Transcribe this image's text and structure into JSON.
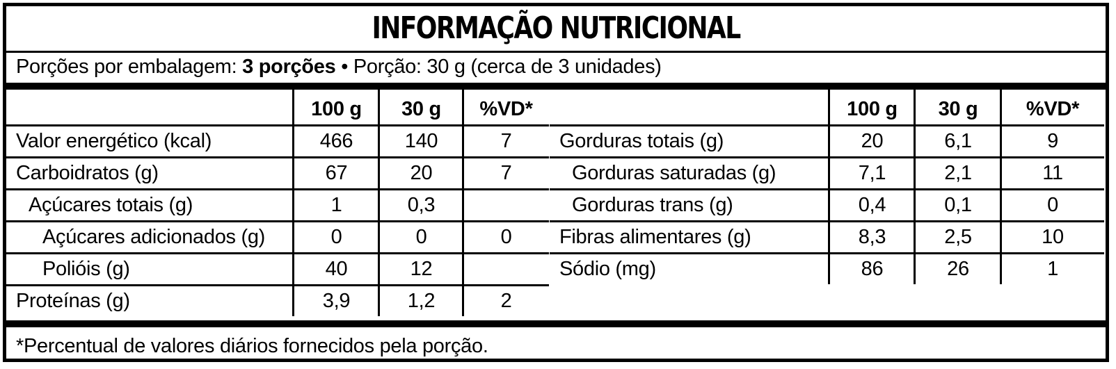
{
  "title": "INFORMAÇÃO NUTRICIONAL",
  "serving": {
    "prefix": "Porções por embalagem: ",
    "portions": "3 porções",
    "suffix": " • Porção: 30 g (cerca de 3 unidades)"
  },
  "columns": [
    "100 g",
    "30 g",
    "%VD*"
  ],
  "left_rows": [
    {
      "label": "Valor energético (kcal)",
      "v100": "466",
      "v30": "140",
      "vd": "7",
      "indent": 0
    },
    {
      "label": "Carboidratos (g)",
      "v100": "67",
      "v30": "20",
      "vd": "7",
      "indent": 0
    },
    {
      "label": "Açúcares totais (g)",
      "v100": "1",
      "v30": "0,3",
      "vd": "",
      "indent": 1
    },
    {
      "label": "Açúcares adicionados (g)",
      "v100": "0",
      "v30": "0",
      "vd": "0",
      "indent": 2
    },
    {
      "label": "Polióis (g)",
      "v100": "40",
      "v30": "12",
      "vd": "",
      "indent": 2
    },
    {
      "label": "Proteínas (g)",
      "v100": "3,9",
      "v30": "1,2",
      "vd": "2",
      "indent": 0
    }
  ],
  "right_rows": [
    {
      "label": "Gorduras totais (g)",
      "v100": "20",
      "v30": "6,1",
      "vd": "9",
      "indent": 0
    },
    {
      "label": "Gorduras saturadas (g)",
      "v100": "7,1",
      "v30": "2,1",
      "vd": "11",
      "indent": 1
    },
    {
      "label": "Gorduras trans (g)",
      "v100": "0,4",
      "v30": "0,1",
      "vd": "0",
      "indent": 1
    },
    {
      "label": "Fibras alimentares (g)",
      "v100": "8,3",
      "v30": "2,5",
      "vd": "10",
      "indent": 0
    },
    {
      "label": "Sódio (mg)",
      "v100": "86",
      "v30": "26",
      "vd": "1",
      "indent": 0
    }
  ],
  "footnote": "*Percentual de valores diários fornecidos pela porção."
}
